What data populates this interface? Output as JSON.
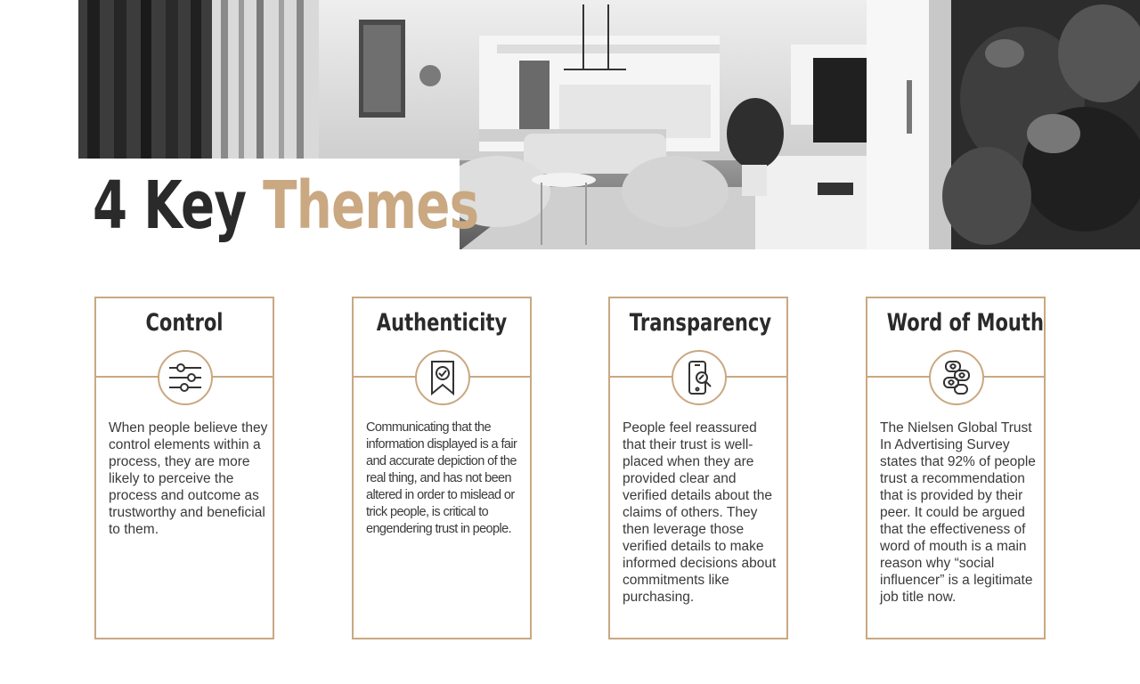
{
  "hero": {
    "image": "black-and-white-living-room-photo"
  },
  "title": {
    "word1": "4 Key",
    "word2": "Themes",
    "accent_color": "#c9a882",
    "dark_color": "#2a2a2a"
  },
  "cards": [
    {
      "heading": "Control",
      "icon": "sliders-icon",
      "body": "When people believe they control elements within a process, they are more likely to perceive the process and outcome as trustworthy and beneficial to them."
    },
    {
      "heading": "Authenticity",
      "icon": "badge-check-icon",
      "body": "Communicating that the information displayed is a fair and accurate depiction of the real thing, and has not been altered in order to mislead or trick people, is critical to engendering trust in people."
    },
    {
      "heading": "Transparency",
      "icon": "phone-search-icon",
      "body": "People feel reassured that their trust is well-placed when they are provided clear and verified details about the claims of others. They then leverage those verified details to make informed decisions about commitments like purchasing."
    },
    {
      "heading": "Word of Mouth",
      "icon": "chat-bubbles-heart-icon",
      "body": "The Nielsen Global Trust In Advertising Survey states that 92% of people trust a recommendation that is provided by their peer. It could be argued that the effectiveness of word of mouth is a main reason why “social influencer” is a legitimate job title now."
    }
  ]
}
